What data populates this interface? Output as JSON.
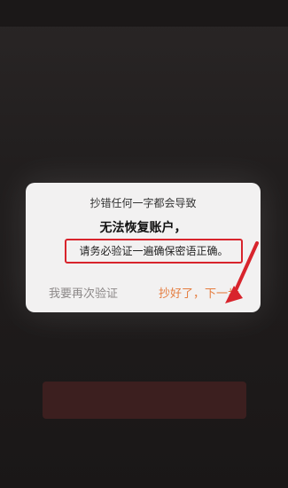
{
  "dialog": {
    "line1": "抄错任何一字都会导致",
    "line2": "无法恢复账户，",
    "line3": "请务必验证一遍确保密语正确。",
    "reverify_label": "我要再次验证",
    "next_label": "抄好了，下一步"
  },
  "colors": {
    "highlight_border": "#d8242c",
    "next_button": "#e57d3f",
    "reverify_button": "#8c8888"
  }
}
